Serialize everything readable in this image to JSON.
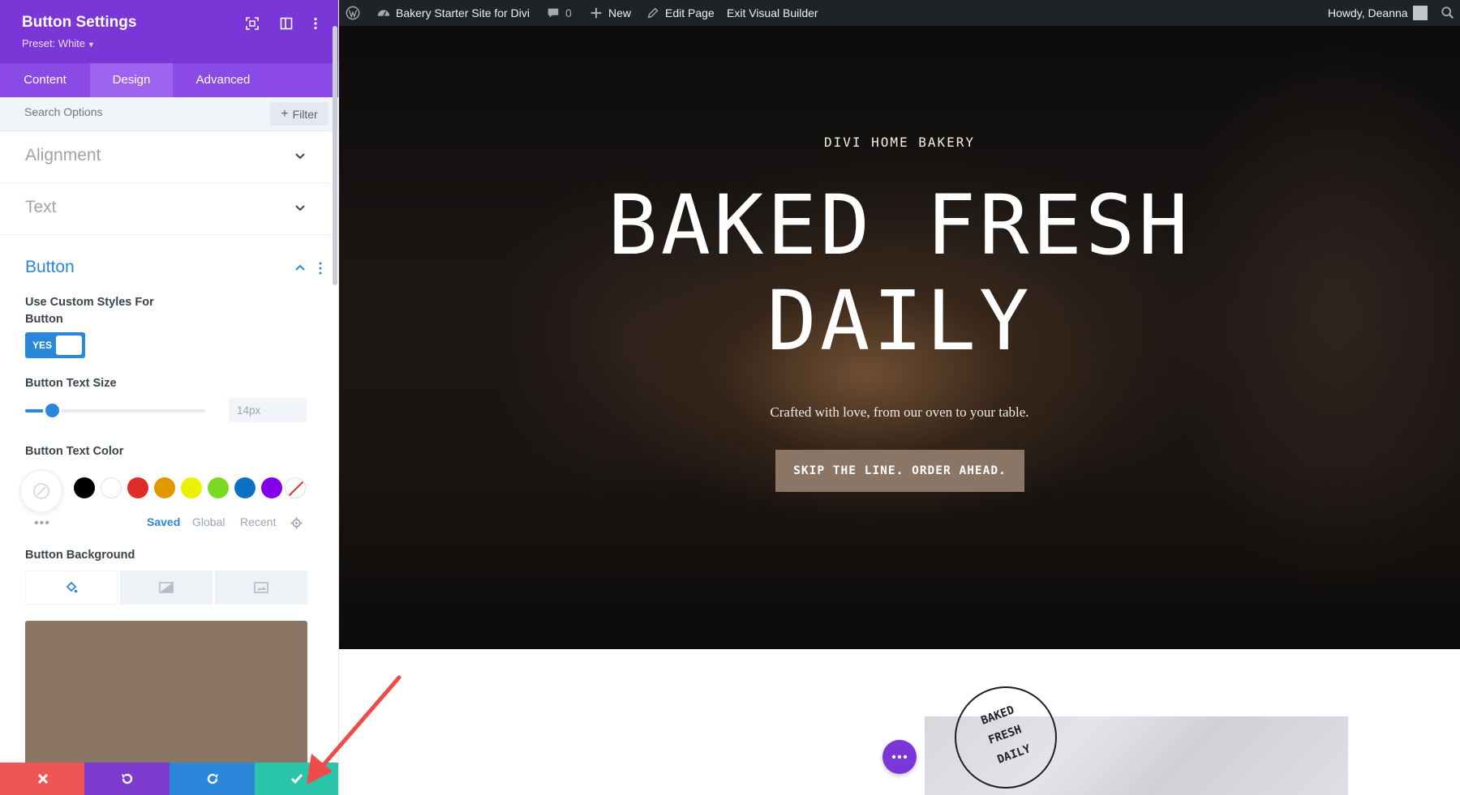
{
  "panel": {
    "title": "Button Settings",
    "preset": "Preset: White",
    "tabs": [
      "Content",
      "Design",
      "Advanced"
    ],
    "active_tab": "Design",
    "search_placeholder": "Search Options",
    "filter_label": "Filter",
    "collapsed_sections": [
      "Alignment",
      "Text"
    ],
    "open_section": "Button",
    "custom_styles_label": "Use Custom Styles For Button",
    "custom_styles_label_line1": "Use Custom Styles For",
    "custom_styles_label_line2": "Button",
    "toggle_value": "YES",
    "text_size_label": "Button Text Size",
    "text_size_value": "14px",
    "text_size_slider_fraction": 0.15,
    "text_color_label": "Button Text Color",
    "swatches": [
      "#000000",
      "#ffffff",
      "#e02b27",
      "#e09900",
      "#edf000",
      "#7cda24",
      "#0c71c3",
      "#8300e9"
    ],
    "palette_tabs": [
      "Saved",
      "Global",
      "Recent"
    ],
    "active_palette_tab": "Saved",
    "background_label": "Button Background",
    "background_color": "#8b7666",
    "accent_color": "#2b87da",
    "header_color": "#7b36d8"
  },
  "bottom_bar": {
    "buttons": [
      {
        "name": "discard",
        "icon": "close-icon",
        "color": "#ef5555"
      },
      {
        "name": "undo",
        "icon": "undo-icon",
        "color": "#7e3bd0"
      },
      {
        "name": "redo",
        "icon": "redo-icon",
        "color": "#2b87da"
      },
      {
        "name": "save",
        "icon": "check-icon",
        "color": "#29c4a9"
      }
    ]
  },
  "admin_bar": {
    "site_name": "Bakery Starter Site for Divi",
    "comments_count": "0",
    "new_label": "New",
    "edit_page_label": "Edit Page",
    "exit_label": "Exit Visual Builder",
    "greeting": "Howdy, Deanna"
  },
  "hero": {
    "eyebrow": "DIVI HOME BAKERY",
    "title_line1": "BAKED FRESH",
    "title_line2": "DAILY",
    "subtitle": "Crafted with love, from our oven to your table.",
    "button_label": "SKIP THE LINE. ORDER AHEAD."
  },
  "below": {
    "stamp_words": [
      "BAKED",
      "FRESH",
      "DAILY"
    ]
  }
}
